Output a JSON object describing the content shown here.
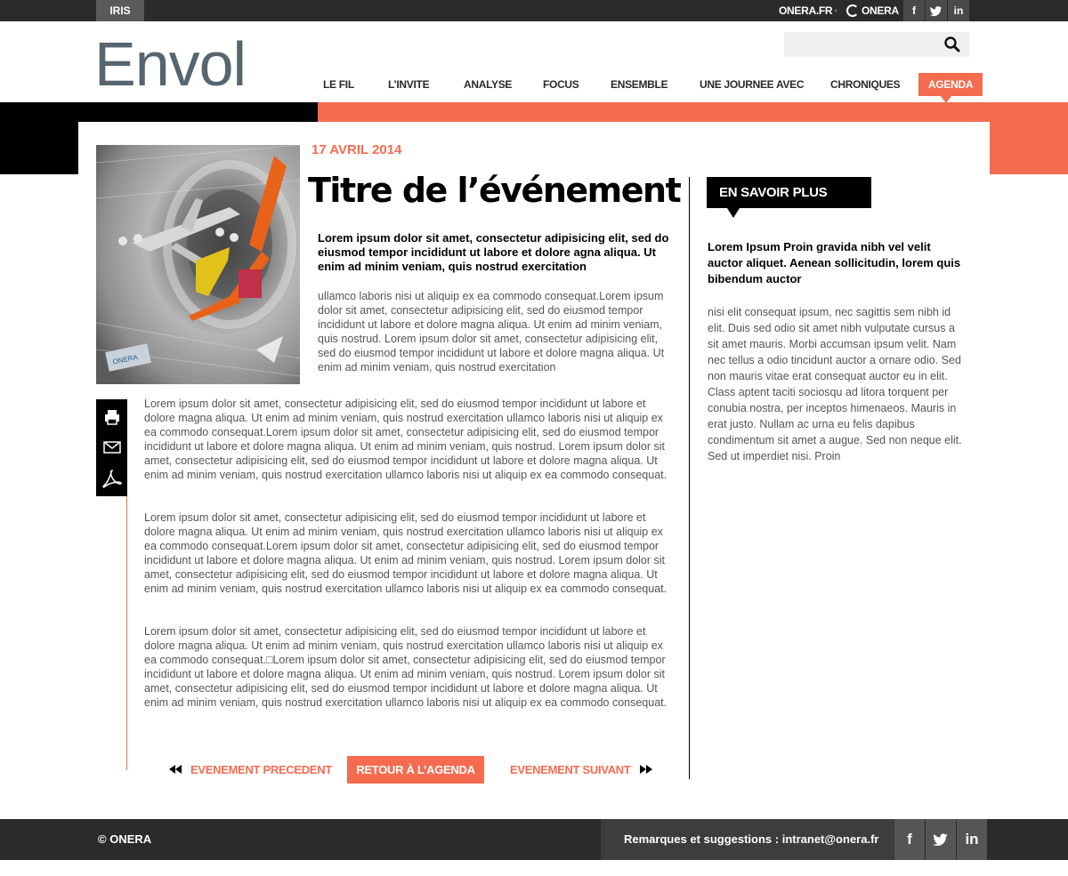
{
  "topbar": {
    "iris": "IRIS",
    "onera_fr": "ONERA.FR",
    "separator": "·",
    "g_onera": "ONERA",
    "social": [
      "f",
      "t",
      "in"
    ]
  },
  "header": {
    "logo": "Envol",
    "search_placeholder": "",
    "nav": [
      "LE FIL",
      "L’INVITE",
      "ANALYSE",
      "FOCUS",
      "ENSEMBLE",
      "UNE JOURNEE AVEC",
      "CHRONIQUES",
      "AGENDA"
    ],
    "active_nav": "AGENDA"
  },
  "article": {
    "date": "17 AVRIL 2014",
    "title": "Titre de l’événement",
    "lead": "Lorem ipsum dolor sit amet, consectetur adipisicing elit, sed do eiusmod tempor incididunt ut labore et dolore agna aliqua. Ut enim ad minim veniam, quis nostrud exercitation",
    "intro": "ullamco laboris nisi ut aliquip ex ea commodo consequat.Lorem ipsum dolor sit amet, consectetur adipisicing elit, sed do eiusmod tempor incididunt ut labore et dolore magna aliqua. Ut enim ad minim veniam, quis nostrud. Lorem ipsum dolor sit amet, consectetur adipisicing elit, sed do eiusmod tempor incididunt ut labore et dolore magna aliqua. Ut enim ad minim veniam, quis nostrud exercitation",
    "paragraphs": [
      "Lorem ipsum dolor sit amet, consectetur adipisicing elit, sed do eiusmod tempor incididunt ut labore et dolore magna aliqua. Ut enim ad minim veniam, quis nostrud exercitation ullamco laboris nisi ut aliquip ex ea commodo consequat.Lorem ipsum dolor sit amet, consectetur adipisicing elit, sed do eiusmod tempor incididunt ut labore et dolore magna aliqua. Ut enim ad minim veniam, quis nostrud. Lorem ipsum dolor sit amet, consectetur adipisicing elit, sed do eiusmod tempor incididunt ut labore et dolore magna aliqua. Ut enim ad minim veniam, quis nostrud exercitation ullamco laboris nisi ut aliquip ex ea commodo consequat.",
      "Lorem ipsum dolor sit amet, consectetur adipisicing elit, sed do eiusmod tempor incididunt ut labore et dolore magna aliqua. Ut enim ad minim veniam, quis nostrud exercitation ullamco laboris nisi ut aliquip ex ea commodo consequat.Lorem ipsum dolor sit amet, consectetur adipisicing elit, sed do eiusmod tempor incididunt ut labore et dolore magna aliqua. Ut enim ad minim veniam, quis nostrud. Lorem ipsum dolor sit amet, consectetur adipisicing elit, sed do eiusmod tempor incididunt ut labore et dolore magna aliqua. Ut enim ad minim veniam, quis nostrud exercitation ullamco laboris nisi ut aliquip ex ea commodo consequat.",
      "Lorem ipsum dolor sit amet, consectetur adipisicing elit, sed do eiusmod tempor incididunt ut labore et dolore magna aliqua. Ut enim ad minim veniam, quis nostrud exercitation ullamco laboris nisi ut aliquip ex ea commodo consequat.□Lorem ipsum dolor sit amet, consectetur adipisicing elit, sed do eiusmod tempor incididunt ut labore et dolore magna aliqua. Ut enim ad minim veniam, quis nostrud. Lorem ipsum dolor sit amet, consectetur adipisicing elit, sed do eiusmod tempor incididunt ut labore et dolore magna aliqua. Ut enim ad minim veniam, quis nostrud exercitation ullamco laboris nisi ut aliquip ex ea commodo consequat."
    ],
    "tools": [
      "print-icon",
      "mail-icon",
      "pdf-icon"
    ],
    "photo_caption": "ONERA"
  },
  "pager": {
    "prev": "EVENEMENT PRECEDENT",
    "back": "RETOUR À L’AGENDA",
    "next": "EVENEMENT SUIVANT"
  },
  "aside": {
    "heading": "EN SAVOIR PLUS",
    "lead": "Lorem Ipsum Proin gravida nibh vel velit auctor aliquet. Aenean sollicitudin, lorem quis bibendum auctor",
    "body": "nisi elit consequat ipsum, nec sagittis sem nibh id elit. Duis sed odio sit amet nibh vulputate cursus a sit amet mauris. Morbi accumsan ipsum velit. Nam nec tellus a odio tincidunt auctor a ornare odio. Sed non  mauris vitae erat consequat auctor eu in elit. Class aptent taciti sociosqu ad litora torquent per conubia nostra, per inceptos himenaeos. Mauris in erat justo. Nullam ac urna eu felis dapibus condimentum sit amet a augue. Sed non neque elit. Sed ut imperdiet nisi. Proin"
  },
  "footer": {
    "copyright": "© ONERA",
    "feedback": "Remarques et suggestions : intranet@onera.fr",
    "social": [
      "f",
      "t",
      "in"
    ]
  },
  "colors": {
    "accent": "#f46b50",
    "dark": "#2b2b2b",
    "logo": "#566570"
  }
}
